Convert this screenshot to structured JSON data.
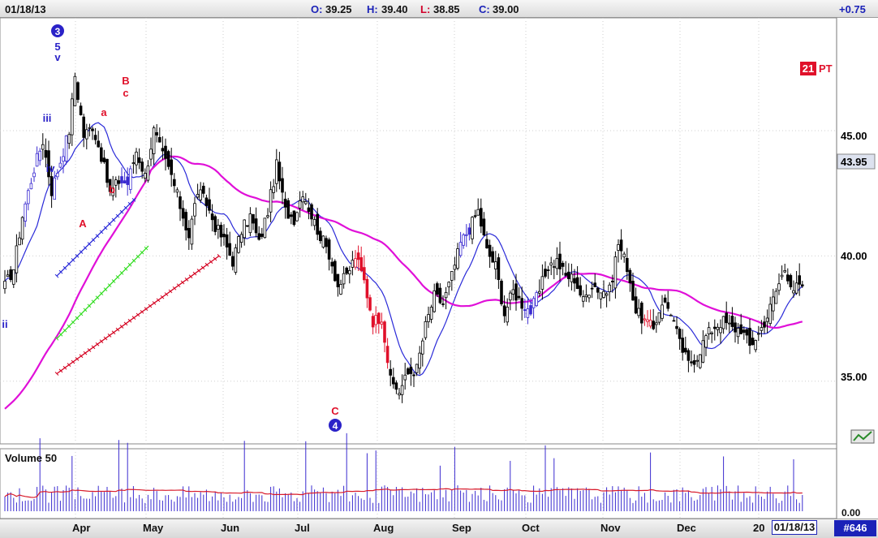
{
  "header": {
    "date": "01/18/13",
    "open_label": "O:",
    "open_value": "39.25",
    "high_label": "H:",
    "high_value": "39.40",
    "low_label": "L:",
    "low_value": "38.85",
    "close_label": "C:",
    "close_value": "39.00",
    "change": "+0.75"
  },
  "price_panel": {
    "ticks": [
      "45.00",
      "40.00",
      "35.00"
    ],
    "last_price_box": "43.95",
    "pt_count": "21",
    "pt_label": "PT"
  },
  "volume_panel": {
    "label": "Volume 50",
    "zero_label": "0.00"
  },
  "x_axis": {
    "months": [
      "Apr",
      "May",
      "Jun",
      "Jul",
      "Aug",
      "Sep",
      "Oct",
      "Nov",
      "Dec"
    ],
    "year_fragment": "20",
    "current_date": "01/18/13",
    "chart_number": "#646"
  },
  "wave_labels": {
    "wave3": "3",
    "sub5": "5",
    "subv": "v",
    "subiii": "iii",
    "subiv": "iv",
    "subii": "ii",
    "A": "A",
    "a": "a",
    "b": "b",
    "B": "B",
    "c": "c",
    "C": "C",
    "wave4": "4"
  },
  "colors": {
    "up_candle": "#ffffff",
    "down_candle": "#000000",
    "blue_candle": "#3a2bd0",
    "red_candle": "#e0102a",
    "ma_long": "#e010d8",
    "ma_short": "#2a2ad8",
    "channel_blue": "#2a2ad8",
    "channel_green": "#33dd22",
    "channel_red": "#d40020",
    "volume_ma": "#d81b2b"
  },
  "chart_data": {
    "type": "candlestick",
    "ylim": [
      32.5,
      49.5
    ],
    "yticks": [
      45,
      40,
      35
    ],
    "months": [
      "Apr",
      "May",
      "Jun",
      "Jul",
      "Aug",
      "Sep",
      "Oct",
      "Nov",
      "Dec"
    ],
    "anchors": [
      [
        0,
        38.8
      ],
      [
        3,
        39.5
      ],
      [
        6,
        41.6
      ],
      [
        10,
        43.5
      ],
      [
        13,
        44.6
      ],
      [
        16,
        42.6
      ],
      [
        19,
        43.8
      ],
      [
        22,
        45.0
      ],
      [
        24,
        47.2
      ],
      [
        27,
        44.8
      ],
      [
        30,
        45.2
      ],
      [
        33,
        44.0
      ],
      [
        36,
        42.5
      ],
      [
        39,
        43.0
      ],
      [
        42,
        42.9
      ],
      [
        45,
        44.2
      ],
      [
        48,
        43.2
      ],
      [
        51,
        45.0
      ],
      [
        54,
        44.0
      ],
      [
        57,
        43.2
      ],
      [
        60,
        42.0
      ],
      [
        63,
        40.8
      ],
      [
        66,
        42.6
      ],
      [
        69,
        42.1
      ],
      [
        72,
        41.2
      ],
      [
        75,
        40.6
      ],
      [
        78,
        39.8
      ],
      [
        81,
        41.0
      ],
      [
        84,
        41.6
      ],
      [
        87,
        40.5
      ],
      [
        90,
        41.8
      ],
      [
        93,
        43.6
      ],
      [
        96,
        41.8
      ],
      [
        99,
        41.5
      ],
      [
        102,
        42.6
      ],
      [
        105,
        41.6
      ],
      [
        108,
        40.8
      ],
      [
        111,
        40.1
      ],
      [
        114,
        38.8
      ],
      [
        117,
        39.2
      ],
      [
        120,
        40.0
      ],
      [
        123,
        39.0
      ],
      [
        126,
        37.4
      ],
      [
        129,
        37.6
      ],
      [
        132,
        35.0
      ],
      [
        135,
        34.6
      ],
      [
        138,
        35.3
      ],
      [
        141,
        35.5
      ],
      [
        144,
        37.2
      ],
      [
        147,
        38.4
      ],
      [
        150,
        38.1
      ],
      [
        153,
        39.2
      ],
      [
        156,
        40.5
      ],
      [
        159,
        41.1
      ],
      [
        162,
        41.8
      ],
      [
        165,
        40.2
      ],
      [
        168,
        39.6
      ],
      [
        171,
        37.7
      ],
      [
        174,
        38.6
      ],
      [
        177,
        38.1
      ],
      [
        180,
        37.8
      ],
      [
        183,
        38.6
      ],
      [
        186,
        39.6
      ],
      [
        189,
        39.8
      ],
      [
        192,
        39.2
      ],
      [
        195,
        39.1
      ],
      [
        198,
        38.2
      ],
      [
        201,
        38.9
      ],
      [
        204,
        38.6
      ],
      [
        207,
        38.6
      ],
      [
        210,
        40.5
      ],
      [
        213,
        39.6
      ],
      [
        216,
        37.8
      ],
      [
        219,
        37.4
      ],
      [
        222,
        37.1
      ],
      [
        225,
        38.2
      ],
      [
        228,
        37.8
      ],
      [
        231,
        36.5
      ],
      [
        234,
        35.7
      ],
      [
        237,
        36.0
      ],
      [
        240,
        36.8
      ],
      [
        243,
        37.2
      ],
      [
        246,
        37.4
      ],
      [
        249,
        37.1
      ],
      [
        252,
        37.1
      ],
      [
        255,
        36.4
      ],
      [
        258,
        36.9
      ],
      [
        261,
        37.6
      ],
      [
        264,
        38.6
      ],
      [
        267,
        39.5
      ],
      [
        270,
        38.7
      ],
      [
        273,
        38.8
      ]
    ],
    "colored_ranges": [
      {
        "from": 7,
        "to": 12,
        "color": "blue"
      },
      {
        "from": 17,
        "to": 21,
        "color": "blue"
      },
      {
        "from": 40,
        "to": 43,
        "color": "blue"
      },
      {
        "from": 120,
        "to": 131,
        "color": "red"
      },
      {
        "from": 156,
        "to": 159,
        "color": "blue"
      },
      {
        "from": 178,
        "to": 182,
        "color": "blue"
      },
      {
        "from": 219,
        "to": 221,
        "color": "red"
      }
    ]
  }
}
